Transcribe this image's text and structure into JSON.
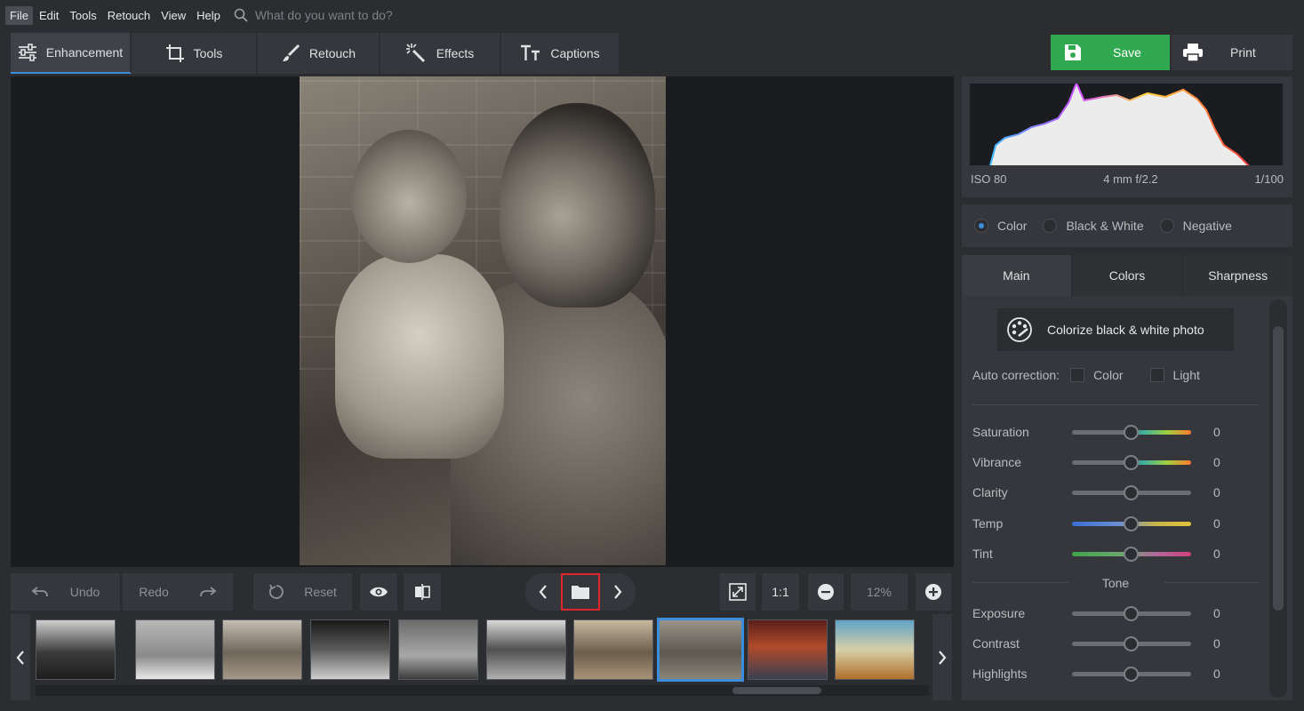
{
  "menu": {
    "items": [
      "File",
      "Edit",
      "Tools",
      "Retouch",
      "View",
      "Help"
    ],
    "search_placeholder": "What do you want to do?"
  },
  "toolbar": {
    "tabs": [
      {
        "label": "Enhancement",
        "icon": "sliders-icon"
      },
      {
        "label": "Tools",
        "icon": "crop-icon"
      },
      {
        "label": "Retouch",
        "icon": "brush-icon"
      },
      {
        "label": "Effects",
        "icon": "magic-wand-icon"
      },
      {
        "label": "Captions",
        "icon": "text-icon"
      }
    ],
    "save_label": "Save",
    "print_label": "Print"
  },
  "controls": {
    "undo_label": "Undo",
    "redo_label": "Redo",
    "reset_label": "Reset",
    "actual_size_label": "1:1",
    "zoom_value": "12%"
  },
  "histogram": {
    "iso": "ISO 80",
    "lens": "4 mm f/2.2",
    "shutter": "1/100"
  },
  "color_mode": {
    "options": [
      "Color",
      "Black & White",
      "Negative"
    ],
    "selected": "Color"
  },
  "panel_tabs": [
    "Main",
    "Colors",
    "Sharpness"
  ],
  "main_panel": {
    "colorize_label": "Colorize black & white photo",
    "auto_correction_label": "Auto correction:",
    "auto_color_label": "Color",
    "auto_light_label": "Light",
    "tone_label": "Tone",
    "sliders": [
      {
        "label": "Saturation",
        "value": "0"
      },
      {
        "label": "Vibrance",
        "value": "0"
      },
      {
        "label": "Clarity",
        "value": "0"
      },
      {
        "label": "Temp",
        "value": "0"
      },
      {
        "label": "Tint",
        "value": "0"
      }
    ],
    "tone_sliders": [
      {
        "label": "Exposure",
        "value": "0"
      },
      {
        "label": "Contrast",
        "value": "0"
      },
      {
        "label": "Highlights",
        "value": "0"
      }
    ]
  },
  "colors": {
    "accent": "#3d8ddb",
    "save_green": "#2fa84f",
    "highlight_red": "#e0262b"
  }
}
